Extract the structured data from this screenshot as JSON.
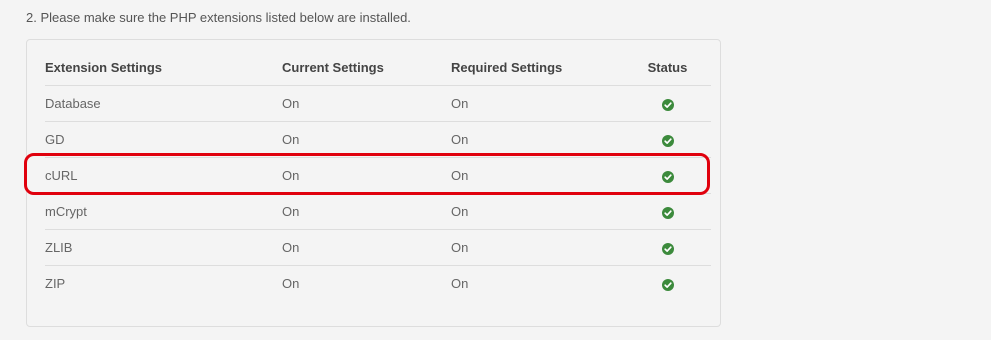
{
  "instruction": "2. Please make sure the PHP extensions listed below are installed.",
  "table": {
    "headers": {
      "extension": "Extension Settings",
      "current": "Current Settings",
      "required": "Required Settings",
      "status": "Status"
    },
    "rows": [
      {
        "extension": "Database",
        "current": "On",
        "required": "On",
        "status_icon": "check-circle-icon"
      },
      {
        "extension": "GD",
        "current": "On",
        "required": "On",
        "status_icon": "check-circle-icon"
      },
      {
        "extension": "cURL",
        "current": "On",
        "required": "On",
        "status_icon": "check-circle-icon"
      },
      {
        "extension": "mCrypt",
        "current": "On",
        "required": "On",
        "status_icon": "check-circle-icon"
      },
      {
        "extension": "ZLIB",
        "current": "On",
        "required": "On",
        "status_icon": "check-circle-icon"
      },
      {
        "extension": "ZIP",
        "current": "On",
        "required": "On",
        "status_icon": "check-circle-icon"
      }
    ]
  },
  "colors": {
    "status_ok": "#3c8a3c",
    "highlight": "#e0000d"
  }
}
